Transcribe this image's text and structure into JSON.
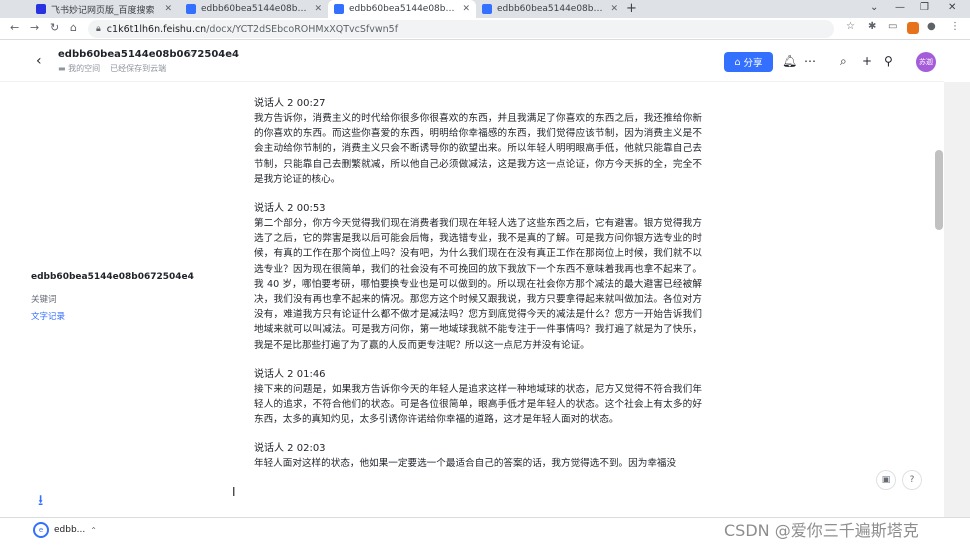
{
  "browser": {
    "tabs": [
      {
        "title": "飞书妙记网页版_百度搜索",
        "favicon_color": "#2932e1",
        "active": false
      },
      {
        "title": "edbb60bea5144e08b0672504",
        "favicon_color": "#3370ff",
        "active": false
      },
      {
        "title": "edbb60bea5144e08b0672504",
        "favicon_color": "#3370ff",
        "active": true
      },
      {
        "title": "edbb60bea5144e08b0672504",
        "favicon_color": "#3370ff",
        "active": false
      }
    ],
    "url_host": "c1k6t1lh6n.feishu.cn",
    "url_path": "/docx/YCT2dSEbcoROHMxXQTvcSfvwn5f"
  },
  "header": {
    "doc_title": "edbb60bea5144e08b0672504e4",
    "breadcrumb_folder": "我的空间",
    "saved_status": "已经保存到云端",
    "share_label": "分享",
    "avatar_text": "苏迦"
  },
  "sidebar": {
    "title": "edbb60bea5144e08b0672504e4",
    "items": [
      {
        "label": "关键词",
        "color": "#646a73"
      },
      {
        "label": "文字记录",
        "color": "#3370ff"
      }
    ]
  },
  "transcript": [
    {
      "speaker": "说话人 2 00:27",
      "text": "我方告诉你，消费主义的时代给你很多你很喜欢的东西，并且我满足了你喜欢的东西之后，我还推给你新的你喜欢的东西。而这些你喜爱的东西，明明给你幸福感的东西，我们觉得应该节制，因为消费主义是不会主动给你节制的，消费主义只会不断诱导你的欲望出来。所以年轻人明明眼高手低，他就只能靠自己去节制，只能靠自己去删繁就减，所以他自己必须做减法，这是我方这一点论证，你方今天拆的全，完全不是我方论证的核心。"
    },
    {
      "speaker": "说话人 2 00:53",
      "text": "第二个部分，你方今天觉得我们现在消费者我们现在年轻人选了这些东西之后，它有避害。银方觉得我方选了之后，它的弊害是我以后可能会后悔，我选错专业，我不是真的了解。可是我方问你银方选专业的时候，有真的工作在那个岗位上吗？没有吧，为什么我们现在在没有真正工作在那岗位上时候，我们就不以选专业？因为现在很简单，我们的社会没有不可挽回的放下我放下一个东西不意味着我再也拿不起来了。我 40 岁，哪怕要考研，哪怕要换专业也是可以做到的。所以现在社会你方那个减法的最大避害已经被解决，我们没有再也拿不起来的情况。那您方这个时候又跟我说，我方只要拿得起来就叫做加法。各位对方没有，难道我方只有论证什么都不做才是减法吗？您方到底觉得今天的减法是什么？您方一开始告诉我们地域来就可以叫减法。可是我方问你，第一地域球我就不能专注于一件事情吗？我打遍了就是为了快乐，我是不是比那些打遍了为了赢的人反而更专注呢？所以这一点尼方并没有论证。"
    },
    {
      "speaker": "说话人 2 01:46",
      "text": "接下来的问题是，如果我方告诉你今天的年轻人是追求这样一种地域球的状态，尼方又觉得不符合我们年轻人的追求，不符合他们的状态。可是各位很简单，眼高手低才是年轻人的状态。这个社会上有太多的好东西，太多的真知灼见，太多引诱你许诺给你幸福的道路，这才是年轻人面对的状态。"
    },
    {
      "speaker": "说话人 2 02:03",
      "text": "年轻人面对这样的状态，他如果一定要选一个最适合自己的答案的话，我方觉得选不到。因为幸福没"
    }
  ],
  "download_shelf": {
    "item_label": "edbb..."
  },
  "watermark": "CSDN @爱你三千遍斯塔克"
}
